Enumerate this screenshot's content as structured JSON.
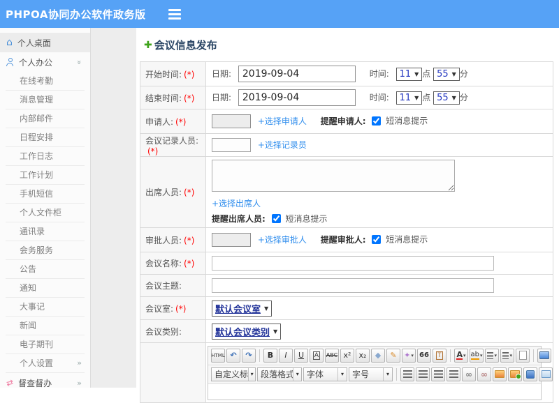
{
  "header": {
    "title": "PHPOA协同办公软件政务版"
  },
  "sidebar": {
    "desktop": "个人桌面",
    "office": "个人办公",
    "sub_items": [
      "在线考勤",
      "消息管理",
      "内部邮件",
      "日程安排",
      "工作日志",
      "工作计划",
      "手机短信",
      "个人文件柜",
      "通讯录",
      "会务服务",
      "公告",
      "通知",
      "大事记",
      "新闻",
      "电子期刊"
    ],
    "settings": "个人设置",
    "supervise": "督查督办"
  },
  "form": {
    "title": "会议信息发布",
    "required_mark": "(*)",
    "start_time": {
      "label": "开始时间:",
      "date_label": "日期:",
      "date_value": "2019-09-04",
      "time_label": "时间:",
      "hour": "11",
      "hour_unit": "点",
      "minute": "55",
      "minute_unit": "分"
    },
    "end_time": {
      "label": "结束时间:",
      "date_label": "日期:",
      "date_value": "2019-09-04",
      "time_label": "时间:",
      "hour": "11",
      "hour_unit": "点",
      "minute": "55",
      "minute_unit": "分"
    },
    "applicant": {
      "label": "申请人:",
      "link": "+选择申请人",
      "remind": "提醒申请人:",
      "sms": "短消息提示"
    },
    "recorder": {
      "label": "会议记录人员:",
      "link": "+选择记录员"
    },
    "attendees": {
      "label": "出席人员:",
      "link": "+选择出席人",
      "remind": "提醒出席人员:",
      "sms": "短消息提示"
    },
    "approver": {
      "label": "审批人员:",
      "link": "+选择审批人",
      "remind": "提醒审批人:",
      "sms": "短消息提示"
    },
    "meeting_name": {
      "label": "会议名称:"
    },
    "meeting_topic": {
      "label": "会议主题:"
    },
    "meeting_room": {
      "label": "会议室:",
      "value": "默认会议室"
    },
    "meeting_category": {
      "label": "会议类别:",
      "value": "默认会议类别"
    }
  },
  "editor": {
    "buttons": {
      "html": "HTML",
      "undo": "↶",
      "redo": "↷",
      "bold": "B",
      "italic": "I",
      "underline": "U",
      "font_border": "A",
      "strikethrough": "ABC",
      "superscript": "x²",
      "subscript": "x₂",
      "eraser": "◆",
      "format_brush": "✎",
      "autotypeset": "✦",
      "quote": "66",
      "paste_text": "T",
      "font_color": "A",
      "highlight": "ab"
    },
    "dropdowns": {
      "custom_title": "自定义标题",
      "paragraph": "段落格式",
      "font_family": "字体",
      "font_size": "字号"
    }
  },
  "colors": {
    "header_blue": "#56a2f6",
    "title_navy": "#2c4766",
    "link_blue": "#2f8ded",
    "required_red": "#ff0000",
    "icon_blue": "#4a90d9",
    "supervise_pink": "#ef7da2",
    "plus_green": "#3fa31c"
  }
}
